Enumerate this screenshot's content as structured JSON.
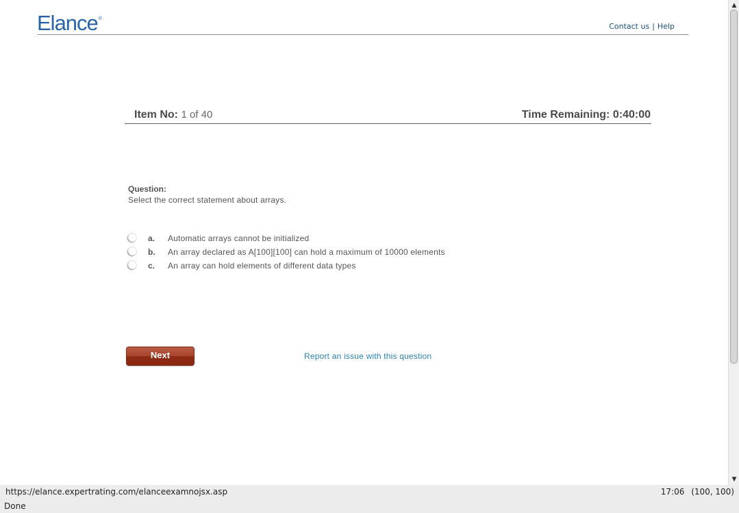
{
  "header": {
    "logo_text": "Elance",
    "logo_mark": "®",
    "contact_label": "Contact us",
    "separator": "|",
    "help_label": "Help"
  },
  "item_bar": {
    "item_label": "Item No:",
    "item_value": "1 of 40",
    "time_label": "Time Remaining:",
    "time_value": "0:40:00"
  },
  "question": {
    "heading": "Question:",
    "text": "Select the correct statement about arrays.",
    "options": [
      {
        "letter": "a.",
        "text": "Automatic arrays cannot be initialized"
      },
      {
        "letter": "b.",
        "text": "An array declared as A[100][100] can hold a maximum of 10000 elements"
      },
      {
        "letter": "c.",
        "text": "An array can hold elements of different data types"
      }
    ]
  },
  "actions": {
    "next_label": "Next",
    "report_label": "Report an issue with this question"
  },
  "statusbar": {
    "url": "https://elance.expertrating.com/elanceexamnojsx.asp",
    "time": "17:06",
    "coords": "(100, 100)",
    "state": "Done"
  },
  "icons": {
    "scroll_up": "scroll-up-arrow",
    "scroll_down": "scroll-down-arrow"
  },
  "colors": {
    "brand_blue": "#2a64a8",
    "link_blue": "#2a82b8",
    "next_button": "#a8432c"
  }
}
